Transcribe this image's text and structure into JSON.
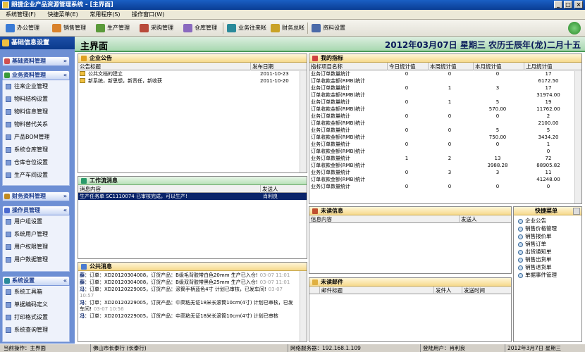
{
  "window": {
    "title": "朗捷企业产品资源管理系统 - [主界面]"
  },
  "menubar": [
    "系统管理(F)",
    "快捷菜单(E)",
    "常用程序(S)",
    "操作窗口(W)"
  ],
  "toolbar": [
    {
      "label": "办公管理",
      "color": "#3a7bd5"
    },
    {
      "label": "销售管理",
      "color": "#d9822b"
    },
    {
      "label": "生产管理",
      "color": "#5a9a3a"
    },
    {
      "label": "采购管理",
      "color": "#b84a3a"
    },
    {
      "label": "仓库管理",
      "color": "#8a6abf"
    },
    {
      "label": "业务往来帐",
      "color": "#2a8a9a"
    },
    {
      "label": "财务总帐",
      "color": "#c9a227"
    },
    {
      "label": "资料设置",
      "color": "#4a6aa8"
    }
  ],
  "sidebar": {
    "header": "基础信息设置",
    "sections": [
      {
        "label": "基础资料管理",
        "items": []
      },
      {
        "label": "业务资料管理",
        "items": [
          "往来企业管理",
          "物料结构设置",
          "物料信息管理",
          "物料替代关系",
          "产品BOM管理",
          "系统仓库管理",
          "仓库仓位设置",
          "生产车间设置"
        ]
      },
      {
        "label": "财务资料管理",
        "items": []
      },
      {
        "label": "操作员管理",
        "items": [
          "用户组设置",
          "系统用户管理",
          "用户权限管理",
          "用户数据管理"
        ]
      },
      {
        "label": "系统设置",
        "items": [
          "系统工具箱",
          "单据编码定义",
          "打印格式设置",
          "系统查询管理"
        ]
      }
    ]
  },
  "main": {
    "title": "主界面",
    "date": "2012年03月07日  星期三  农历壬辰年(龙)二月十五"
  },
  "announcements": {
    "title": "企业公告",
    "columns": [
      "公告标题",
      "发布日期"
    ],
    "rows": [
      [
        "公共文档的建立",
        "2011-10-23"
      ],
      [
        "新系统，新思想，新责任，新收获",
        "2011-10-20"
      ]
    ]
  },
  "metrics": {
    "title": "我的指标",
    "columns": [
      "指标项目名称",
      "今日统计值",
      "本周统计值",
      "本月统计值",
      "上月统计值"
    ],
    "rows": [
      [
        "业务订单数量统计",
        "0",
        "0",
        "0",
        "17"
      ],
      [
        "订单收款金额(RMB)统计",
        "",
        "",
        "",
        "6172.50"
      ],
      [
        "业务订单数量统计",
        "0",
        "1",
        "3",
        "17"
      ],
      [
        "订单收款金额(RMB)统计",
        "",
        "",
        "",
        "31974.00"
      ],
      [
        "业务订单数量统计",
        "0",
        "1",
        "5",
        "19"
      ],
      [
        "订单收款金额(RMB)统计",
        "",
        "",
        "570.00",
        "11762.00"
      ],
      [
        "业务订单数量统计",
        "0",
        "0",
        "0",
        "2"
      ],
      [
        "订单收款金额(RMB)统计",
        "",
        "",
        "",
        "2100.00"
      ],
      [
        "业务订单数量统计",
        "0",
        "0",
        "5",
        "5"
      ],
      [
        "订单收款金额(RMB)统计",
        "",
        "",
        "750.00",
        "3434.20"
      ],
      [
        "业务订单数量统计",
        "0",
        "0",
        "0",
        "1"
      ],
      [
        "订单收款金额(RMB)统计",
        "",
        "",
        "",
        "0"
      ],
      [
        "业务订单数量统计",
        "1",
        "2",
        "13",
        "72"
      ],
      [
        "订单收款金额(RMB)统计",
        "",
        "",
        "3988.28",
        "88905.82"
      ],
      [
        "业务订单数量统计",
        "0",
        "3",
        "3",
        "11"
      ],
      [
        "订单收款金额(RMB)统计",
        "",
        "",
        "",
        "41248.00"
      ],
      [
        "业务订单数量统计",
        "0",
        "0",
        "0",
        "0"
      ]
    ]
  },
  "workflow": {
    "title": "工作流消息",
    "columns": [
      "消息内容",
      "发送人"
    ],
    "rows": [
      [
        "生产任务单 SC1110074 已审核完成，可以生产!",
        "肖利良"
      ]
    ]
  },
  "public_msg": {
    "title": "公共消息",
    "rows": [
      [
        "薛",
        "：订单：XD20120304008，订货产品：B级毛背胶带白色20mm 生产已入仓!",
        "03-07 11:01"
      ],
      [
        "薛",
        "：订单：XD20120304008，订货产品：B级双背胶带黑色25mm 生产已入仓!",
        "03-07 11:01"
      ],
      [
        "冯",
        "：订单：XD20120229005，订货产品：滚筒手柄蓝色4寸 计划已审核，已发车间!",
        "03-07 10:57"
      ],
      [
        "冯",
        "：订单：XD20120229005，订货产品：中高粘无证18米长滚筒10cm(4寸) 计划已审核，已发车间!",
        "03-07 10:56"
      ],
      [
        "冯",
        "：订单：XD20120229005，订货产品：中高粘无证18米长滚筒10cm(4寸) 计划已审核",
        ""
      ]
    ]
  },
  "unread_info": {
    "title": "未读信息",
    "columns": [
      "信息内容",
      "发送人"
    ]
  },
  "unread_mail": {
    "title": "未读邮件",
    "columns": [
      "邮件标题",
      "发件人",
      "发送时间"
    ]
  },
  "quickmenu": {
    "title": "快捷菜单",
    "items": [
      "企业公告",
      "销售价格管理",
      "销售报价单",
      "销售订单",
      "出货通知单",
      "销售出货单",
      "销售退货单",
      "单据事件管理"
    ]
  },
  "statusbar": {
    "op": "当前操作：主界面",
    "company": "佛山市长泰行 (长泰行)",
    "server": "网络服务器：192.168.1.109",
    "user": "登陆用户：肖利良",
    "date": "2012年3月7日 星期三"
  }
}
